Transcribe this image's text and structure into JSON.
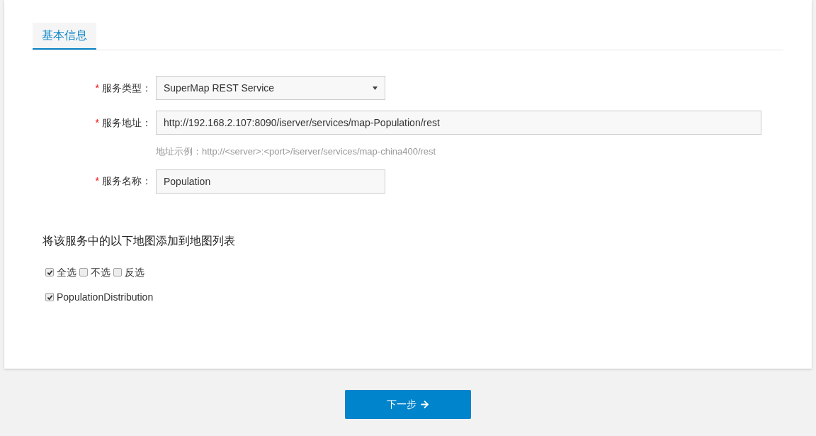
{
  "tabs": [
    {
      "label": "基本信息",
      "selected": true
    }
  ],
  "fields": [
    {
      "kind": "select",
      "required_mark": "*",
      "label": "服务类型：",
      "value": "SuperMap REST Service"
    },
    {
      "kind": "long_text",
      "required_mark": "*",
      "label": "服务地址：",
      "value": "http://192.168.2.107:8090/iserver/services/map-Population/rest",
      "hint": "地址示例：http://<server>:<port>/iserver/services/map-china400/rest"
    },
    {
      "kind": "text",
      "required_mark": "*",
      "label": "服务名称：",
      "value": "Population"
    }
  ],
  "section_title": "将该服务中的以下地图添加到地图列表",
  "select_options": [
    {
      "label": "全选",
      "checked": true
    },
    {
      "label": "不选",
      "checked": false
    },
    {
      "label": "反选",
      "checked": false
    }
  ],
  "maps": [
    {
      "label": "PopulationDistribution",
      "checked": true
    }
  ],
  "next_button": {
    "label": "下一步"
  }
}
